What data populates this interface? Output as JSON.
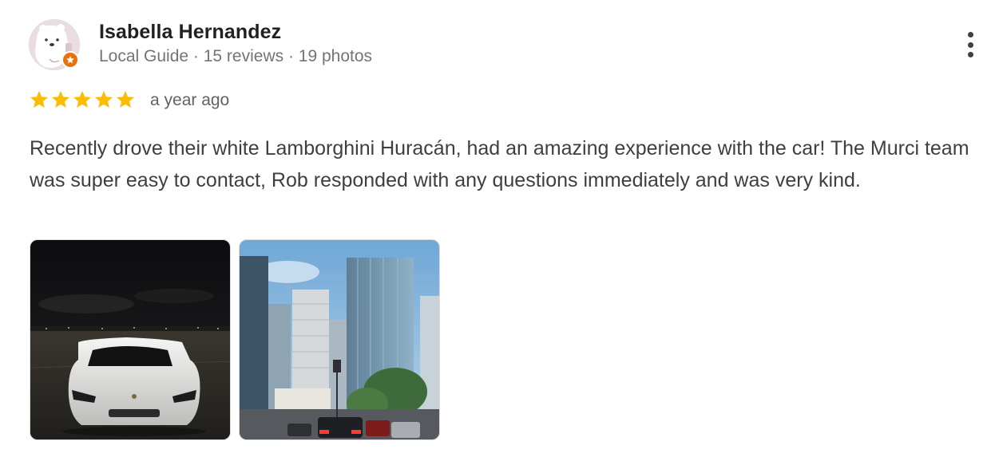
{
  "reviewer": {
    "name": "Isabella Hernandez",
    "meta": "Local Guide · 15 reviews · 19 photos",
    "badge_icon": "local-guide-star-icon",
    "badge_color": "#e8710a"
  },
  "rating": {
    "stars": 5,
    "max_stars": 5,
    "star_color": "#fbbc04",
    "time": "a year ago"
  },
  "review": {
    "text": "Recently drove their white Lamborghini Huracán, had an amazing experience with the car! The Murci team was super easy to contact, Rob responded with any questions immediately and was very kind."
  },
  "photos": [
    {
      "icon": "photo-white-lamborghini-night"
    },
    {
      "icon": "photo-city-skyscrapers-traffic"
    }
  ],
  "menu": {
    "icon": "more-vert-icon"
  }
}
